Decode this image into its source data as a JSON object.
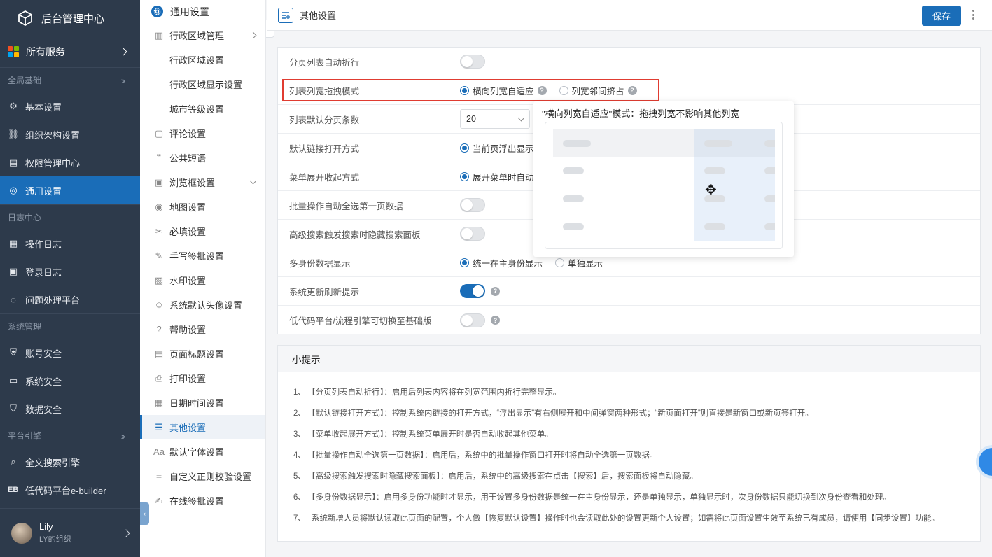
{
  "app": {
    "title": "后台管理中心",
    "all_services": "所有服务"
  },
  "sidebar": {
    "groups": [
      {
        "label": "全局基础",
        "items": [
          {
            "label": "基本设置",
            "icon": "gear-icon"
          },
          {
            "label": "组织架构设置",
            "icon": "org-tree-icon"
          },
          {
            "label": "权限管理中心",
            "icon": "id-card-icon"
          },
          {
            "label": "通用设置",
            "icon": "settings-circle-icon",
            "active": true
          }
        ]
      },
      {
        "label": "日志中心",
        "items": [
          {
            "label": "操作日志",
            "icon": "document-icon"
          },
          {
            "label": "登录日志",
            "icon": "login-log-icon"
          },
          {
            "label": "问题处理平台",
            "icon": "planet-icon"
          }
        ]
      },
      {
        "label": "系统管理",
        "items": [
          {
            "label": "账号安全",
            "icon": "shield-icon"
          },
          {
            "label": "系统安全",
            "icon": "monitor-icon"
          },
          {
            "label": "数据安全",
            "icon": "data-shield-icon"
          }
        ]
      },
      {
        "label": "平台引擎",
        "items": [
          {
            "label": "全文搜索引擎",
            "icon": "search-icon"
          },
          {
            "label": "低代码平台e-builder",
            "icon": "eb-icon"
          }
        ]
      }
    ],
    "user": {
      "name": "Lily",
      "org": "LY的组织"
    }
  },
  "submenu": {
    "title": "通用设置",
    "items": [
      {
        "label": "行政区域管理",
        "icon": "region-icon",
        "arrow": "right"
      },
      {
        "label": "行政区域设置",
        "sub": true
      },
      {
        "label": "行政区域显示设置",
        "sub": true
      },
      {
        "label": "城市等级设置",
        "sub": true
      },
      {
        "label": "评论设置",
        "icon": "comment-icon"
      },
      {
        "label": "公共短语",
        "icon": "quote-icon"
      },
      {
        "label": "浏览框设置",
        "icon": "browser-icon",
        "arrow": "down"
      },
      {
        "label": "地图设置",
        "icon": "map-pin-icon"
      },
      {
        "label": "必填设置",
        "icon": "scissors-icon"
      },
      {
        "label": "手写签批设置",
        "icon": "pen-icon"
      },
      {
        "label": "水印设置",
        "icon": "watermark-icon"
      },
      {
        "label": "系统默认头像设置",
        "icon": "avatar-icon"
      },
      {
        "label": "帮助设置",
        "icon": "help-icon"
      },
      {
        "label": "页面标题设置",
        "icon": "page-title-icon"
      },
      {
        "label": "打印设置",
        "icon": "printer-icon"
      },
      {
        "label": "日期时间设置",
        "icon": "calendar-icon"
      },
      {
        "label": "其他设置",
        "icon": "list-settings-icon",
        "active": true
      },
      {
        "label": "默认字体设置",
        "icon": "font-icon"
      },
      {
        "label": "自定义正则校验设置",
        "icon": "regex-icon"
      },
      {
        "label": "在线签批设置",
        "icon": "sign-icon"
      }
    ]
  },
  "page": {
    "title": "其他设置",
    "save_label": "保存"
  },
  "settings": [
    {
      "label": "分页列表自动折行",
      "type": "toggle",
      "on": false
    },
    {
      "label": "列表列宽拖拽模式",
      "type": "radio",
      "options": [
        "横向列宽自适应",
        "列宽邻间挤占"
      ],
      "selected": 0,
      "help": true
    },
    {
      "label": "列表默认分页条数",
      "type": "select",
      "value": "20"
    },
    {
      "label": "默认链接打开方式",
      "type": "radio",
      "options": [
        "当前页浮出显示"
      ],
      "selected": 0
    },
    {
      "label": "菜单展开收起方式",
      "type": "radio",
      "options": [
        "展开菜单时自动收"
      ],
      "selected": 0
    },
    {
      "label": "批量操作自动全选第一页数据",
      "type": "toggle",
      "on": false
    },
    {
      "label": "高级搜索触发搜索时隐藏搜索面板",
      "type": "toggle",
      "on": false
    },
    {
      "label": "多身份数据显示",
      "type": "radio",
      "options": [
        "统一在主身份显示",
        "单独显示"
      ],
      "selected": 0
    },
    {
      "label": "系统更新刷新提示",
      "type": "toggle",
      "on": true,
      "help": true
    },
    {
      "label": "低代码平台/流程引擎可切换至基础版",
      "type": "toggle",
      "on": false,
      "help": true
    }
  ],
  "popover": {
    "title": "\"横向列宽自适应\"模式：拖拽列宽不影响其他列宽"
  },
  "tips": {
    "title": "小提示",
    "items": [
      "【分页列表自动折行】：启用后列表内容将在列宽范围内折行完整显示。",
      "【默认链接打开方式】：控制系统内链接的打开方式，“浮出显示”有右侧展开和中间弹窗两种形式；“新页面打开”则直接是新窗口或新页签打开。",
      "【菜单收起展开方式】：控制系统菜单展开时是否自动收起其他菜单。",
      "【批量操作自动全选第一页数据】：启用后，系统中的批量操作窗口打开时将自动全选第一页数据。",
      "【高级搜索触发搜索时隐藏搜索面板】：启用后，系统中的高级搜索在点击【搜索】后，搜索面板将自动隐藏。",
      "【多身份数据显示】：启用多身份功能时才显示，用于设置多身份数据是统一在主身份显示，还是单独显示，单独显示时，次身份数据只能切换到次身份查看和处理。",
      "系统新增人员将默认读取此页面的配置，个人做【恢复默认设置】操作时也会读取此处的设置更新个人设置；如需将此页面设置生效至系统已有成员，请使用【同步设置】功能。"
    ]
  },
  "colors": {
    "sidebar_bg": "#2d3a4b",
    "accent": "#1a6db8",
    "highlight_border": "#e03c31"
  }
}
